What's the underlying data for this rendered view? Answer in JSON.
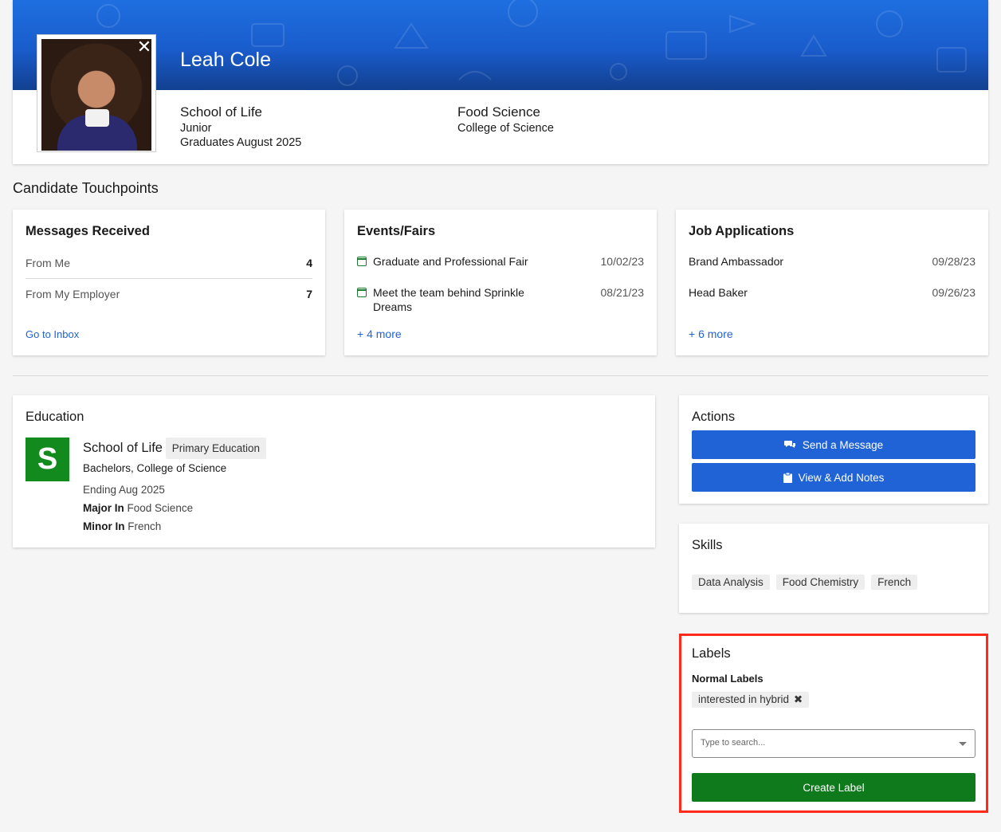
{
  "profile": {
    "name": "Leah Cole",
    "school": "School of Life",
    "class_year": "Junior",
    "graduation": "Graduates August 2025",
    "major": "Food Science",
    "college": "College of Science"
  },
  "touchpoints": {
    "title": "Candidate Touchpoints",
    "messages": {
      "title": "Messages Received",
      "rows": [
        {
          "label": "From Me",
          "count": "4"
        },
        {
          "label": "From My Employer",
          "count": "7"
        }
      ],
      "link": "Go to Inbox"
    },
    "events": {
      "title": "Events/Fairs",
      "items": [
        {
          "name": "Graduate and Professional Fair",
          "date": "10/02/23"
        },
        {
          "name": "Meet the team behind Sprinkle",
          "name2": "Dreams",
          "date": "08/21/23"
        }
      ],
      "more": "+ 4 more"
    },
    "applications": {
      "title": "Job Applications",
      "items": [
        {
          "name": "Brand Ambassador",
          "date": "09/28/23"
        },
        {
          "name": "Head Baker",
          "date": "09/26/23"
        }
      ],
      "more": "+ 6 more"
    }
  },
  "education": {
    "title": "Education",
    "logo_letter": "S",
    "school": "School of Life",
    "tag": "Primary Education",
    "degree": "Bachelors, College of Science",
    "ending": "Ending Aug 2025",
    "major_label": "Major In",
    "major": "Food Science",
    "minor_label": "Minor In",
    "minor": "French"
  },
  "actions": {
    "title": "Actions",
    "send_message": "Send a Message",
    "notes": "View & Add Notes"
  },
  "skills": {
    "title": "Skills",
    "items": [
      "Data Analysis",
      "Food Chemistry",
      "French"
    ]
  },
  "labels": {
    "title": "Labels",
    "normal_title": "Normal Labels",
    "chip": "interested in hybrid",
    "search_placeholder": "Type to search...",
    "create": "Create Label"
  },
  "colors": {
    "primary_blue": "#1f63d6",
    "green": "#0f7a1c",
    "highlight_red": "#ff2a1a"
  }
}
